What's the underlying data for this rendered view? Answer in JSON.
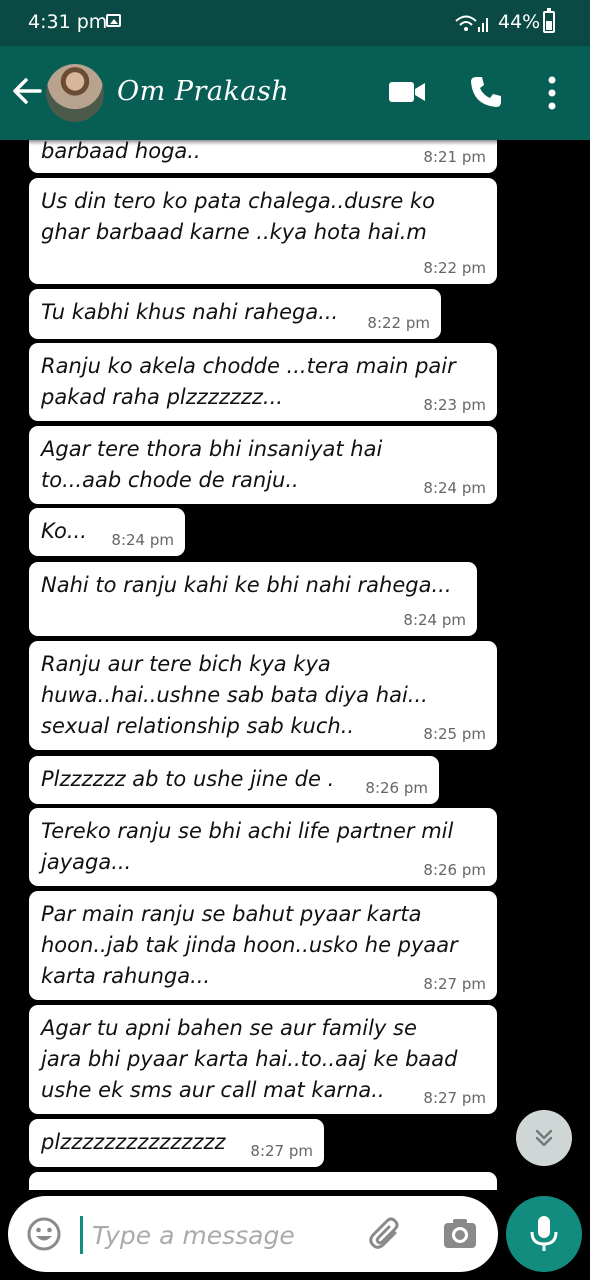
{
  "status_bar": {
    "time": "4:31 pm",
    "battery": "44%"
  },
  "header": {
    "contact_name": "Om Prakash"
  },
  "messages": [
    {
      "text": "barbaad hoga..",
      "time": "8:21 pm"
    },
    {
      "text": "Us din tero ko pata chalega..dusre ko\nghar barbaad karne ..kya hota hai.m",
      "time": "8:22 pm"
    },
    {
      "text": "Tu kabhi khus nahi rahega...",
      "time": "8:22 pm"
    },
    {
      "text": "Ranju ko akela chodde ...tera main pair\npakad raha plzzzzzzz...",
      "time": "8:23 pm"
    },
    {
      "text": "Agar tere thora bhi insaniyat hai\nto...aab chode de ranju..",
      "time": "8:24 pm"
    },
    {
      "text": "Ko...",
      "time": "8:24 pm"
    },
    {
      "text": "Nahi to ranju kahi ke bhi nahi rahega...",
      "time": "8:24 pm"
    },
    {
      "text": "Ranju aur tere bich kya kya\nhuwa..hai..ushne sab bata diya hai...\nsexual relationship sab kuch..",
      "time": "8:25 pm"
    },
    {
      "text": "Plzzzzzz ab to ushe jine de .",
      "time": "8:26 pm"
    },
    {
      "text": "Tereko ranju se bhi achi life partner mil\njayaga...",
      "time": "8:26 pm"
    },
    {
      "text": "Par main ranju se bahut pyaar karta\nhoon..jab tak jinda hoon..usko he pyaar\nkarta rahunga...",
      "time": "8:27 pm"
    },
    {
      "text": "Agar tu apni bahen se aur family se\njara bhi pyaar karta hai..to..aaj ke baad\nushe ek sms aur call mat karna..",
      "time": "8:27 pm"
    },
    {
      "text": "plzzzzzzzzzzzzzzz",
      "time": "8:27 pm"
    },
    {
      "text": "",
      "time": ""
    }
  ],
  "composer": {
    "placeholder": "Type a message"
  },
  "colors": {
    "header": "#075e54",
    "status_bar": "#0b4a44",
    "accent": "#128c7e",
    "bubble": "#ffffff"
  },
  "icons": [
    "back-arrow-icon",
    "video-call-icon",
    "phone-icon",
    "more-vert-icon",
    "emoji-icon",
    "attach-icon",
    "camera-icon",
    "mic-icon",
    "chevron-double-down-icon"
  ]
}
